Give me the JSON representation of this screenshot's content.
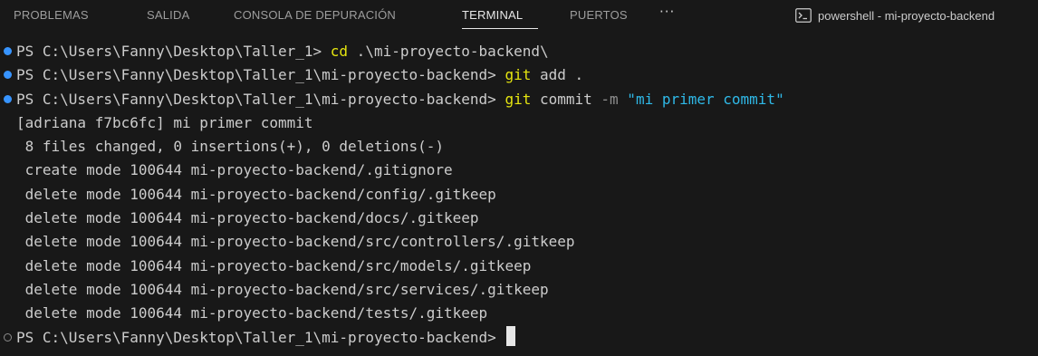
{
  "tabs": [
    {
      "label": "PROBLEMAS",
      "active": false
    },
    {
      "label": "SALIDA",
      "active": false
    },
    {
      "label": "CONSOLA DE DEPURACIÓN",
      "active": false
    },
    {
      "label": "TERMINAL",
      "active": true
    },
    {
      "label": "PUERTOS",
      "active": false
    }
  ],
  "more_label": "···",
  "terminal_name": "powershell - mi-proyecto-backend",
  "prompt": "PS C:\\Users\\Fanny\\Desktop\\Taller_1> ",
  "prompt2": "PS C:\\Users\\Fanny\\Desktop\\Taller_1\\mi-proyecto-backend> ",
  "commands": [
    {
      "cmd": "cd",
      "args": " .\\mi-proyecto-backend\\"
    },
    {
      "cmd": "git",
      "args": " add ."
    },
    {
      "cmd": "git",
      "args": " commit ",
      "flag": "-m",
      "str": " \"mi primer commit\""
    }
  ],
  "output": [
    "[adriana f7bc6fc] mi primer commit",
    " 8 files changed, 0 insertions(+), 0 deletions(-)",
    " create mode 100644 mi-proyecto-backend/.gitignore",
    " delete mode 100644 mi-proyecto-backend/config/.gitkeep",
    " delete mode 100644 mi-proyecto-backend/docs/.gitkeep",
    " delete mode 100644 mi-proyecto-backend/src/controllers/.gitkeep",
    " delete mode 100644 mi-proyecto-backend/src/models/.gitkeep",
    " delete mode 100644 mi-proyecto-backend/src/services/.gitkeep",
    " delete mode 100644 mi-proyecto-backend/tests/.gitkeep"
  ],
  "colors": {
    "background": "#181818",
    "decoration_success": "#3794ff",
    "command": "#e5e510",
    "string": "#2fb9e8"
  },
  "icons": {
    "terminal": "terminal-powershell-icon",
    "more": "ellipsis-icon"
  }
}
